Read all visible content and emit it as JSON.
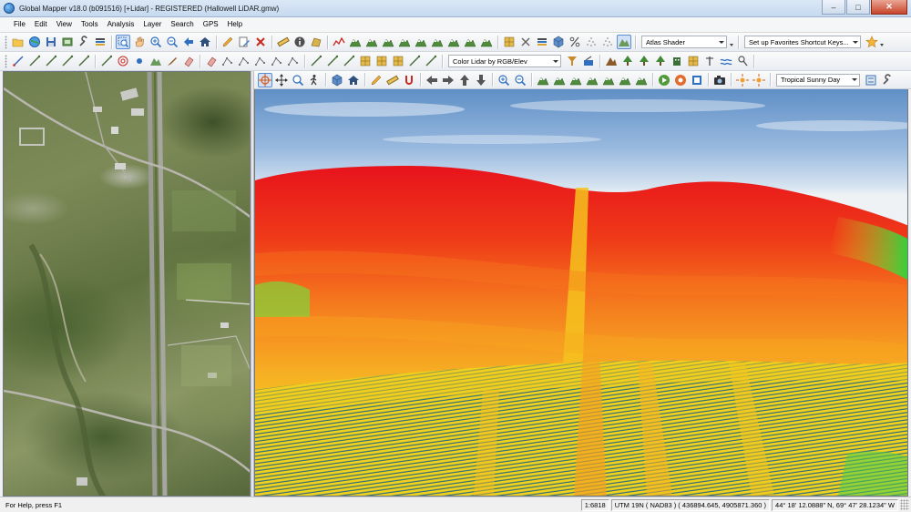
{
  "window": {
    "title": "Global Mapper v18.0 (b091516) [+Lidar] - REGISTERED (Hallowell LiDAR.gmw)",
    "minimize_glyph": "–",
    "maximize_glyph": "□",
    "close_glyph": "✕"
  },
  "menu": [
    "File",
    "Edit",
    "View",
    "Tools",
    "Analysis",
    "Layer",
    "Search",
    "GPS",
    "Help"
  ],
  "toolbar_file": {
    "shader_combo": "Atlas Shader",
    "favorites_combo": "Set up Favorites Shortcut Keys..."
  },
  "toolbar_lidar": {
    "color_combo": "Color Lidar by RGB/Elev"
  },
  "toolbar_3d": {
    "sky_combo": "Tropical Sunny Day"
  },
  "status": {
    "help_text": "For Help, press F1",
    "scale": "1:6818",
    "projection": "UTM 19N ( NAD83 ) ( 436894.645, 4905871.360 )",
    "latlon": "44° 18' 12.0888\" N, 69° 47' 28.1234\" W"
  },
  "icons": {
    "toolbar1": [
      "open-folder-icon",
      "globe-icon",
      "save-icon",
      "export-icon",
      "wrench-icon",
      "layers-icon",
      "zoom-select-icon",
      "pan-hand-icon",
      "zoom-in-icon",
      "zoom-out-icon",
      "back-arrow-icon",
      "home-icon",
      "pencil-icon",
      "edit-icon",
      "delete-x-icon",
      "ruler-icon",
      "info-icon",
      "area-measure-icon",
      "path-profile-icon",
      "terrain-icon",
      "terrain-icon",
      "terrain-icon",
      "terrain-icon",
      "terrain-icon",
      "terrain-icon",
      "terrain-icon",
      "terrain-icon",
      "terrain-icon",
      "grid-icon",
      "script-icon",
      "layers-icon",
      "3d-cube-icon",
      "percent-icon",
      "lidar-icon",
      "lidar-icon",
      "chart-icon"
    ],
    "toolbar2": [
      "digitize-icon",
      "line-icon",
      "line-icon",
      "line-icon",
      "line-icon",
      "line-icon",
      "target-icon",
      "point-icon",
      "chart-icon",
      "brush-icon",
      "eraser-icon",
      "eraser-icon",
      "node-icon",
      "node-icon",
      "node-icon",
      "node-icon",
      "node-icon",
      "line-icon",
      "line-icon",
      "line-icon",
      "grid-icon",
      "grid-icon",
      "grid-icon",
      "line-icon",
      "line-icon",
      "filter-icon",
      "paint-icon",
      "mountain-icon",
      "tree-icon",
      "tree-icon",
      "tree-icon",
      "building-icon",
      "grid-icon",
      "pole-icon",
      "water-icon",
      "pin-icon"
    ],
    "toolbar3": [
      "crosshair-icon",
      "move-icon",
      "zoom-icon",
      "walk-icon",
      "3d-cube-icon",
      "home-icon",
      "pencil-icon",
      "ruler-icon",
      "magnet-icon",
      "arrow-left-icon",
      "arrow-right-icon",
      "arrow-up-icon",
      "arrow-down-icon",
      "zoom-in-icon",
      "zoom-out-icon",
      "terrain-icon",
      "terrain-icon",
      "terrain-icon",
      "terrain-icon",
      "terrain-icon",
      "terrain-icon",
      "terrain-icon",
      "play-icon",
      "record-icon",
      "stop-icon",
      "camera-icon",
      "sun-icon",
      "sun-icon",
      "settings-icon",
      "wrench-icon"
    ]
  },
  "colors": {
    "lidar_high": "#e8131c",
    "lidar_mid": "#f57b1e",
    "lidar_low": "#f3e21a",
    "lidar_ground": "#0e4f8c",
    "sky_top": "#5f8fc6"
  }
}
